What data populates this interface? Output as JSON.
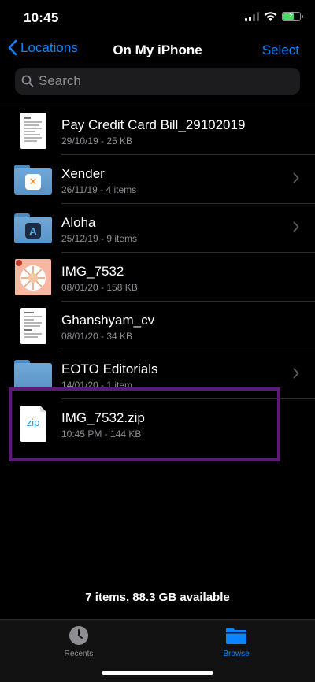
{
  "status_bar": {
    "time": "10:45"
  },
  "nav": {
    "back_label": "Locations",
    "title": "On My iPhone",
    "select_label": "Select"
  },
  "search": {
    "placeholder": "Search"
  },
  "files": [
    {
      "name": "Pay Credit Card Bill_29102019",
      "meta": "29/10/19 - 25 KB",
      "kind": "document"
    },
    {
      "name": "Xender",
      "meta": "26/11/19 - 4 items",
      "kind": "folder"
    },
    {
      "name": "Aloha",
      "meta": "25/12/19 - 9 items",
      "kind": "folder"
    },
    {
      "name": "IMG_7532",
      "meta": "08/01/20 - 158 KB",
      "kind": "image"
    },
    {
      "name": "Ghanshyam_cv",
      "meta": "08/01/20 - 34 KB",
      "kind": "document"
    },
    {
      "name": "EOTO Editorials",
      "meta": "14/01/20 - 1 item",
      "kind": "folder"
    },
    {
      "name": "IMG_7532.zip",
      "meta": "10:45 PM - 144 KB",
      "kind": "archive",
      "thumb_label": "zip",
      "highlighted": true
    }
  ],
  "summary": "7 items, 88.3 GB available",
  "tabs": [
    {
      "label": "Recents",
      "icon": "clock-icon",
      "active": false
    },
    {
      "label": "Browse",
      "icon": "folder-icon",
      "active": true
    }
  ],
  "colors": {
    "accent": "#0a84ff",
    "highlight_border": "#5d1b78",
    "background": "#000000",
    "secondary_text": "#8e8e93"
  }
}
